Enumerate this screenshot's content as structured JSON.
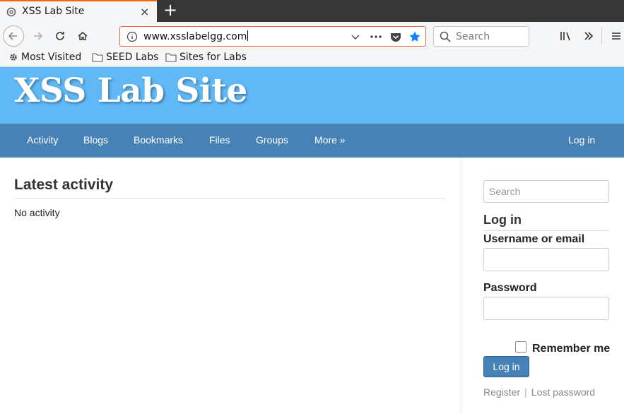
{
  "browser": {
    "tab_title": "XSS Lab Site",
    "tab_close": "×",
    "new_tab": "+",
    "url": "www.xsslabelgg.com",
    "search_placeholder": "Search",
    "bookmarks": [
      "Most Visited",
      "SEED Labs",
      "Sites for Labs"
    ]
  },
  "site": {
    "title": "XSS Lab Site",
    "nav": [
      "Activity",
      "Blogs",
      "Bookmarks",
      "Files",
      "Groups",
      "More »"
    ],
    "login_link": "Log in"
  },
  "main": {
    "heading": "Latest activity",
    "empty_text": "No activity"
  },
  "sidebar": {
    "search_placeholder": "Search",
    "login_heading": "Log in",
    "username_label": "Username or email",
    "password_label": "Password",
    "remember_label": "Remember me",
    "login_button": "Log in",
    "register": "Register",
    "separator": "|",
    "lost_password": "Lost password"
  },
  "colors": {
    "header_bg": "#60b8f7",
    "menu_bg": "#4782b7"
  }
}
